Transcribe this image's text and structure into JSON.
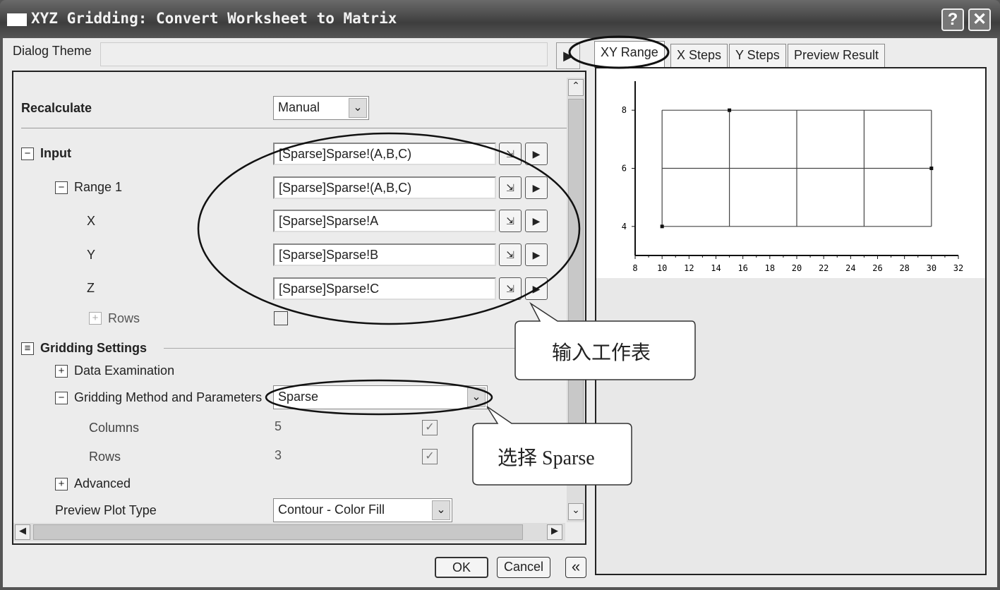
{
  "window": {
    "title": "XYZ Gridding: Convert Worksheet to Matrix",
    "help": "?",
    "close": "✕"
  },
  "theme": {
    "label": "Dialog Theme",
    "value": ""
  },
  "recalculate": {
    "label": "Recalculate",
    "value": "Manual"
  },
  "input": {
    "label": "Input",
    "value": "[Sparse]Sparse!(A,B,C)",
    "range1": {
      "label": "Range 1",
      "value": "[Sparse]Sparse!(A,B,C)"
    },
    "x": {
      "label": "X",
      "value": "[Sparse]Sparse!A"
    },
    "y": {
      "label": "Y",
      "value": "[Sparse]Sparse!B"
    },
    "z": {
      "label": "Z",
      "value": "[Sparse]Sparse!C"
    },
    "rows": {
      "label": "Rows"
    }
  },
  "gridding": {
    "label": "Gridding Settings",
    "data_exam": "Data Examination",
    "method_label": "Gridding Method and Parameters",
    "method_value": "Sparse",
    "columns": {
      "label": "Columns",
      "value": "5",
      "checked": true
    },
    "rows": {
      "label": "Rows",
      "value": "3",
      "checked": true
    },
    "advanced": "Advanced"
  },
  "preview_type": {
    "label": "Preview Plot Type",
    "value": "Contour - Color Fill"
  },
  "tabs": [
    "XY Range",
    "X Steps",
    "Y Steps",
    "Preview Result"
  ],
  "buttons": {
    "ok": "OK",
    "cancel": "Cancel",
    "collapse": "«"
  },
  "callouts": {
    "input": "输入工作表",
    "sparse": "选择 Sparse"
  },
  "chart_data": {
    "type": "scatter",
    "xlim": [
      8,
      32
    ],
    "ylim": [
      3,
      9
    ],
    "xticks": [
      "8",
      "10",
      "12",
      "14",
      "16",
      "18",
      "20",
      "22",
      "24",
      "26",
      "28",
      "30",
      "32"
    ],
    "yticks": [
      "4",
      "6",
      "8"
    ],
    "grid_x": [
      10,
      15,
      20,
      25,
      30
    ],
    "grid_y": [
      4,
      6,
      8
    ],
    "points": [
      {
        "x": 10,
        "y": 4
      },
      {
        "x": 15,
        "y": 8
      },
      {
        "x": 30,
        "y": 6
      }
    ]
  }
}
